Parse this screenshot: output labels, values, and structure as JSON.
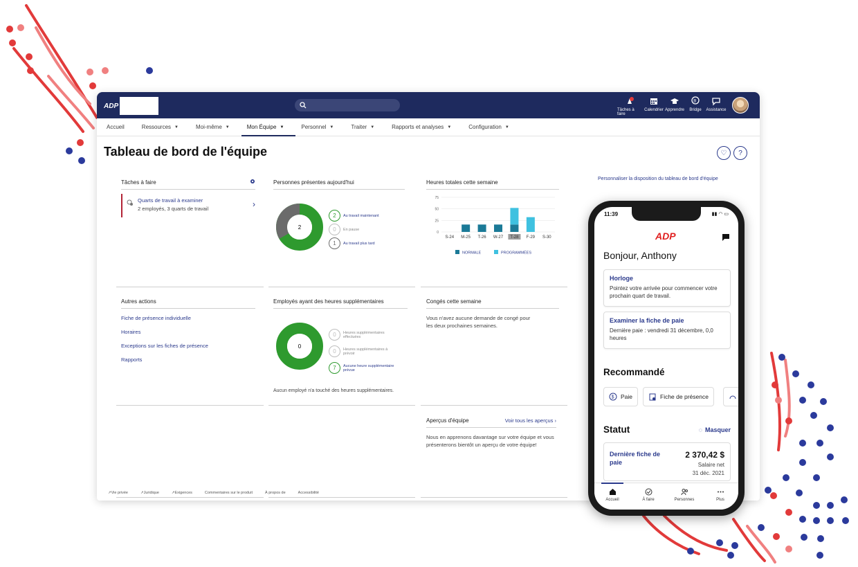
{
  "topbar": {
    "tools": [
      {
        "label": "Tâches à faire",
        "icon": "tasks-icon"
      },
      {
        "label": "Calendrier",
        "icon": "calendar-icon"
      },
      {
        "label": "Apprendre",
        "icon": "graduation-cap-icon"
      },
      {
        "label": "Bridge",
        "icon": "bridge-icon"
      },
      {
        "label": "Assistance",
        "icon": "chat-bubble-icon"
      }
    ]
  },
  "nav": {
    "items": [
      {
        "label": "Accueil",
        "has_menu": false
      },
      {
        "label": "Ressources",
        "has_menu": true
      },
      {
        "label": "Moi-même",
        "has_menu": true
      },
      {
        "label": "Mon Équipe",
        "has_menu": true,
        "active": true
      },
      {
        "label": "Personnel",
        "has_menu": true
      },
      {
        "label": "Traiter",
        "has_menu": true
      },
      {
        "label": "Rapports et analyses",
        "has_menu": true
      },
      {
        "label": "Configuration",
        "has_menu": true
      }
    ]
  },
  "page": {
    "title": "Tableau de bord de l'équipe",
    "customize_link": "Personnaliser la disposition du tableau de bord d'équipe"
  },
  "tasks_card": {
    "title": "Tâches à faire",
    "item_title": "Quarts de travail à examiner",
    "item_sub": "2 employés, 3 quarts de travail"
  },
  "present_card": {
    "title": "Personnes présentes aujourd'hui",
    "center": "2",
    "legend": [
      {
        "value": "2",
        "label": "Au travail maintenant",
        "color": "#2e9a2e"
      },
      {
        "value": "0",
        "label": "En pause",
        "color": "#bdbdbd"
      },
      {
        "value": "1",
        "label": "Au travail plus tard",
        "color": "#6b6b6b"
      }
    ]
  },
  "hours_card": {
    "title": "Heures totales cette semaine"
  },
  "chart_data": {
    "type": "bar",
    "categories": [
      "S-24",
      "M-25",
      "T-26",
      "W-27",
      "T-28",
      "F-29",
      "S-30"
    ],
    "series": [
      {
        "name": "NORMALE",
        "values": [
          0,
          16,
          16,
          16,
          16,
          0,
          0
        ],
        "color": "#1b7a97"
      },
      {
        "name": "PROGRAMMÉES",
        "values": [
          0,
          0,
          0,
          0,
          36,
          32,
          0
        ],
        "color": "#3fc1e0"
      }
    ],
    "yticks": [
      0,
      25,
      50,
      75
    ],
    "ylim": [
      0,
      75
    ],
    "highlight": "T-28",
    "legend_placement": "bottom",
    "grid": true
  },
  "other_actions": {
    "title": "Autres actions",
    "links": [
      "Fiche de présence individuelle",
      "Horaires",
      "Exceptions sur les fiches de présence",
      "Rapports"
    ]
  },
  "overtime_card": {
    "title": "Employés ayant des heures supplémentaires",
    "center": "0",
    "legend": [
      {
        "value": "0",
        "label": "Heures supplémentaires effectuées",
        "color": "#bdbdbd"
      },
      {
        "value": "0",
        "label": "Heures supplémentaires à prévoir",
        "color": "#bdbdbd"
      },
      {
        "value": "7",
        "label": "Aucune heure supplémentaire prévue",
        "color": "#2e9a2e"
      }
    ],
    "note": "Aucun employé n'a touché des heures supplémentaires."
  },
  "leave_card": {
    "title": "Congés cette semaine",
    "text": "Vous n'avez aucune demande de congé pour les deux prochaines semaines."
  },
  "insights_card": {
    "title": "Aperçus d'équipe",
    "link": "Voir tous les aperçus",
    "text": "Nous en apprenons davantage sur votre équipe et vous présenterons bientôt un aperçu de votre équipe!"
  },
  "footer": {
    "links": [
      "Vie privée",
      "Juridique",
      "Exigences",
      "Commentaires sur le produit",
      "À propos de",
      "Accessibilité"
    ]
  },
  "phone": {
    "time": "11:39",
    "greeting": "Bonjour, Anthony",
    "clock_card": {
      "title": "Horloge",
      "text": "Pointez votre arrivée pour commencer votre prochain quart de travail."
    },
    "pay_card": {
      "title": "Examiner la fiche de paie",
      "text": "Dernière paie : vendredi 31 décembre, 0,0 heures"
    },
    "recommended_title": "Recommandé",
    "chips": [
      "Paie",
      "Fiche de présence"
    ],
    "status_title": "Statut",
    "hide_label": "Masquer",
    "last_pay": {
      "title": "Dernière fiche de paie",
      "amount": "2 370,42 $",
      "label": "Salaire net",
      "date": "31 déc. 2021"
    },
    "tabs": [
      "Accueil",
      "À faire",
      "Personnes",
      "Plus"
    ]
  }
}
